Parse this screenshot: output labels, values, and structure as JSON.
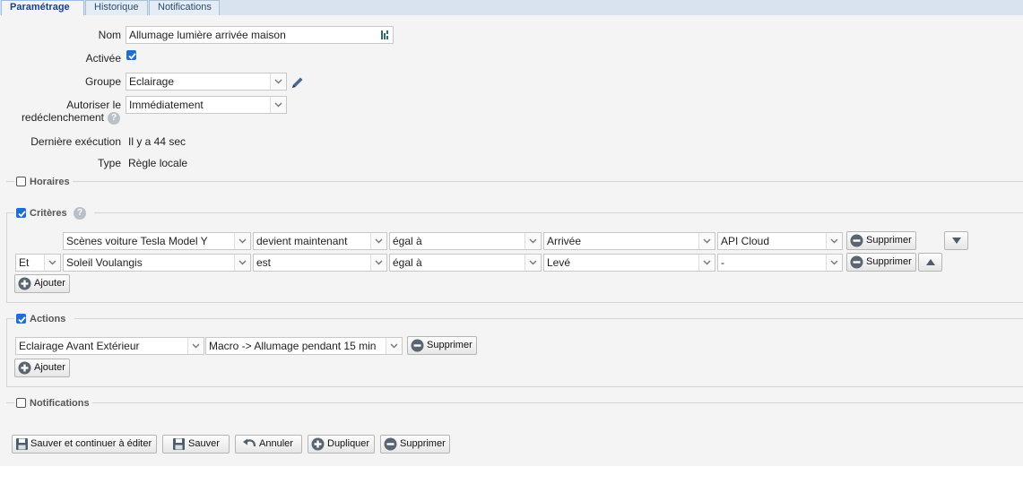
{
  "tabs": [
    {
      "label": "Paramétrage"
    },
    {
      "label": "Historique"
    },
    {
      "label": "Notifications"
    }
  ],
  "form": {
    "nom": {
      "label": "Nom",
      "value": "Allumage lumière arrivée maison"
    },
    "activee": {
      "label": "Activée",
      "checked": true
    },
    "groupe": {
      "label": "Groupe",
      "value": "Eclairage"
    },
    "autoriser": {
      "label_line1": "Autoriser le",
      "label_line2": "redéclenchement",
      "value": "Immédiatement"
    },
    "derniere": {
      "label": "Dernière exécution",
      "value": "Il y a 44 sec"
    },
    "type": {
      "label": "Type",
      "value": "Règle locale"
    }
  },
  "sections": {
    "horaires": {
      "title": "Horaires",
      "checked": false
    },
    "criteres": {
      "title": "Critères",
      "checked": true
    },
    "actions": {
      "title": "Actions",
      "checked": true
    },
    "notifications": {
      "title": "Notifications",
      "checked": false
    }
  },
  "criteria": [
    {
      "connector": "",
      "device": "Scènes voiture Tesla Model Y",
      "condition": "devient maintenant",
      "operator": "égal à",
      "value": "Arrivée",
      "source": "API Cloud",
      "delete": "Supprimer",
      "move": "down"
    },
    {
      "connector": "Et",
      "device": "Soleil Voulangis",
      "condition": "est",
      "operator": "égal à",
      "value": "Levé",
      "source": "-",
      "delete": "Supprimer",
      "move": "up"
    }
  ],
  "criteria_add": "Ajouter",
  "actions": [
    {
      "device": "Eclairage Avant Extérieur",
      "action": "Macro -> Allumage pendant 15 min",
      "delete": "Supprimer"
    }
  ],
  "actions_add": "Ajouter",
  "footer": {
    "save_continue": "Sauver et continuer à éditer",
    "save": "Sauver",
    "cancel": "Annuler",
    "duplicate": "Dupliquer",
    "delete": "Supprimer"
  },
  "colors": {
    "accent": "#1e6fd0",
    "tab_active_text": "#15428b"
  }
}
